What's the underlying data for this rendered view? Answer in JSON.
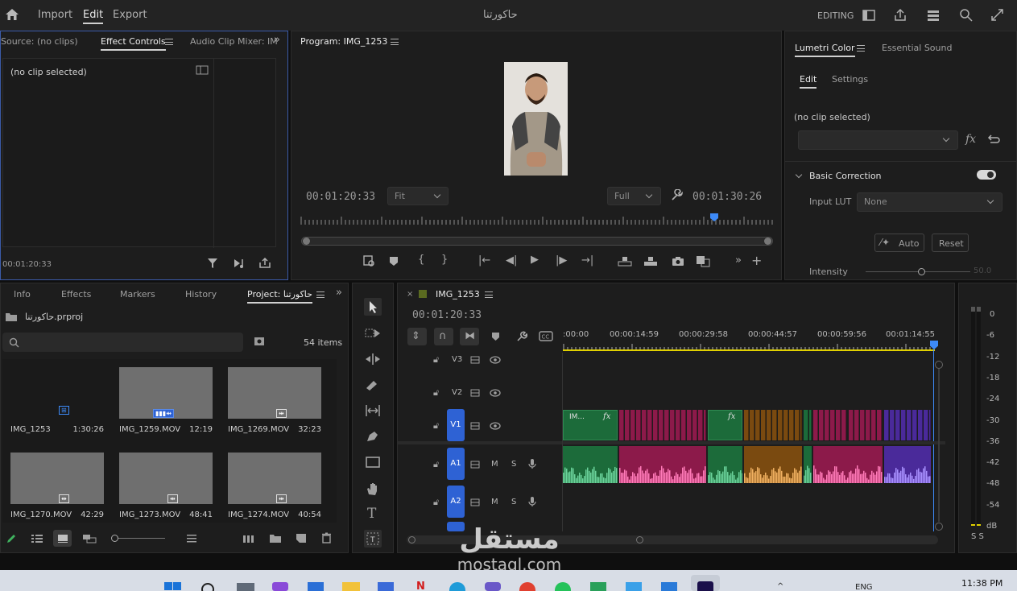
{
  "menu": {
    "import": "Import",
    "edit": "Edit",
    "export": "Export",
    "project_title": "حاكورتنا",
    "workspace": "EDITING"
  },
  "source_panel": {
    "tabs": [
      "Source: (no clips)",
      "Effect Controls",
      "Audio Clip Mixer: IM"
    ],
    "no_clip": "(no clip selected)",
    "timecode": "00:01:20:33"
  },
  "program": {
    "title": "Program: IMG_1253",
    "timecode_left": "00:01:20:33",
    "fit": "Fit",
    "quality": "Full",
    "timecode_right": "00:01:30:26"
  },
  "lumetri": {
    "tabs": [
      "Lumetri Color",
      "Essential Sound"
    ],
    "subtabs": [
      "Edit",
      "Settings"
    ],
    "no_clip": "(no clip selected)",
    "section": "Basic Correction",
    "input_lut_label": "Input LUT",
    "input_lut_value": "None",
    "auto": "Auto",
    "reset": "Reset",
    "intensity_label": "Intensity",
    "intensity_value": "50.0"
  },
  "project": {
    "tabs": [
      "Info",
      "Effects",
      "Markers",
      "History",
      "Project: حاكورتنا"
    ],
    "file": "حاكورتنا.prproj",
    "items_count": "54 items",
    "clips": [
      {
        "name": "IMG_1253",
        "duration": "1:30:26"
      },
      {
        "name": "IMG_1259.MOV",
        "duration": "12:19"
      },
      {
        "name": "IMG_1269.MOV",
        "duration": "32:23"
      },
      {
        "name": "IMG_1270.MOV",
        "duration": "42:29"
      },
      {
        "name": "IMG_1273.MOV",
        "duration": "48:41"
      },
      {
        "name": "IMG_1274.MOV",
        "duration": "40:54"
      }
    ]
  },
  "timeline": {
    "sequence": "IMG_1253",
    "timecode": "00:01:20:33",
    "ruler": [
      ":00:00",
      "00:00:14:59",
      "00:00:29:58",
      "00:00:44:57",
      "00:00:59:56",
      "00:01:14:55"
    ],
    "tracks": [
      "V3",
      "V2",
      "V1",
      "A1",
      "A2"
    ],
    "track_m": "M",
    "track_s": "S",
    "clip_label": "IM...",
    "fx": "fx"
  },
  "meter": {
    "scale": [
      "0",
      "-6",
      "-12",
      "-18",
      "-24",
      "-30",
      "-36",
      "-42",
      "-48",
      "-54",
      "dB"
    ],
    "solo": "S  S"
  },
  "watermark": {
    "arabic": "مستقل",
    "latin": "mostaql.com"
  },
  "taskbar": {
    "lang": "ENG",
    "time": "11:38 PM"
  },
  "colors": {
    "accent_blue": "#2e62d4",
    "clip_green": "#1c6b3a",
    "clip_pink": "#8c1a4a",
    "clip_orange": "#7a4a10",
    "clip_purple": "#4a2a9a",
    "playhead": "#3d8af7"
  }
}
